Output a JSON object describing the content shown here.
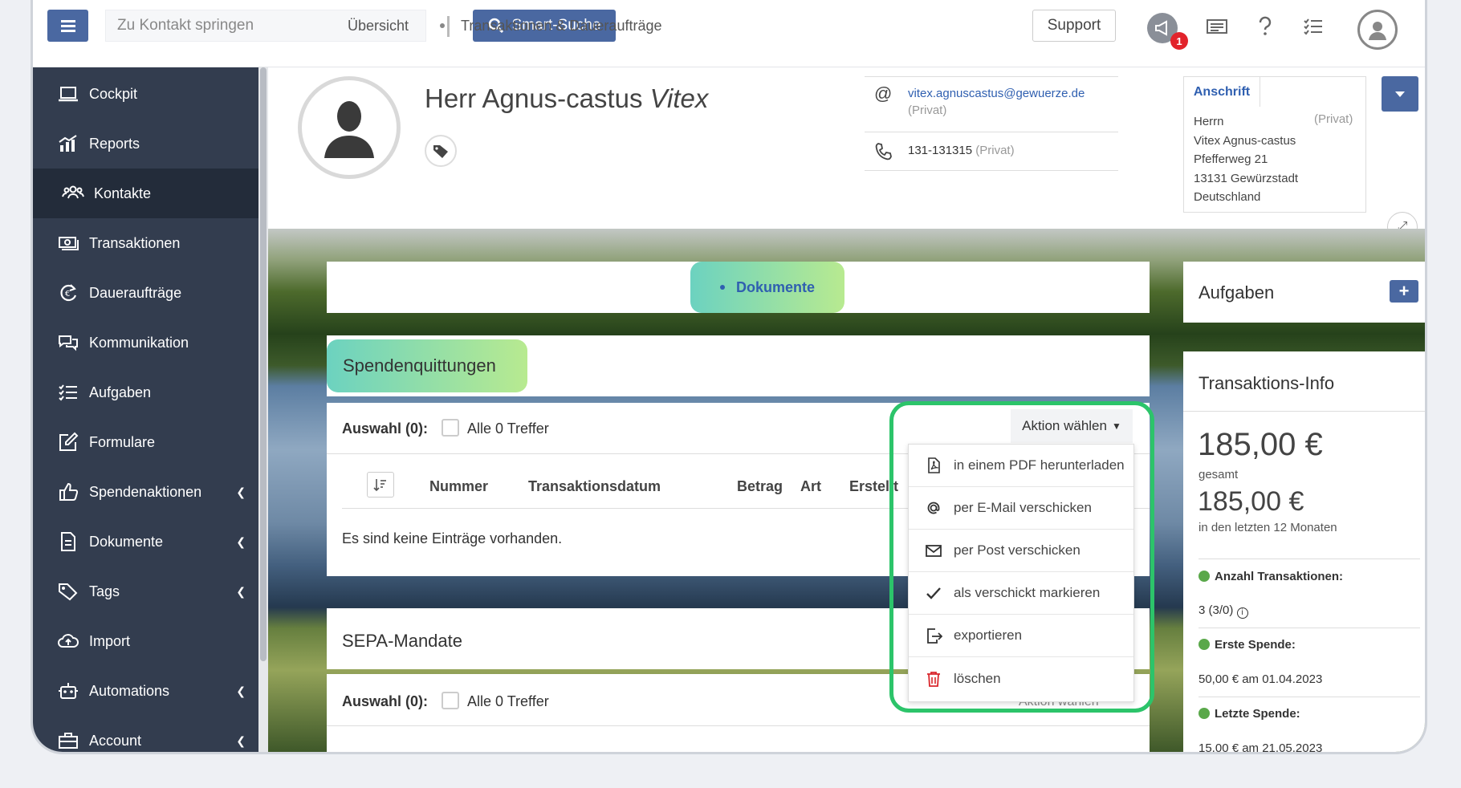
{
  "topbar": {
    "jump_placeholder": "Zu Kontakt springen",
    "smart_search": "Smart-Suche",
    "support": "Support",
    "notification_count": "1"
  },
  "sidebar": {
    "items": [
      {
        "label": "Cockpit",
        "icon": "laptop-icon"
      },
      {
        "label": "Reports",
        "icon": "chart-icon"
      },
      {
        "label": "Kontakte",
        "icon": "users-icon"
      },
      {
        "label": "Transaktionen",
        "icon": "money-icon"
      },
      {
        "label": "Daueraufträge",
        "icon": "recurring-icon"
      },
      {
        "label": "Kommunikation",
        "icon": "chat-icon"
      },
      {
        "label": "Aufgaben",
        "icon": "tasks-icon"
      },
      {
        "label": "Formulare",
        "icon": "edit-icon"
      },
      {
        "label": "Spendenaktionen",
        "icon": "thumbs-up-icon"
      },
      {
        "label": "Dokumente",
        "icon": "document-icon"
      },
      {
        "label": "Tags",
        "icon": "tags-icon"
      },
      {
        "label": "Import",
        "icon": "cloud-upload-icon"
      },
      {
        "label": "Automations",
        "icon": "robot-icon"
      },
      {
        "label": "Account",
        "icon": "briefcase-icon"
      }
    ]
  },
  "profile": {
    "salutation": "Herr Agnus-castus",
    "surname": "Vitex",
    "email": "vitex.agnuscastus@gewuerze.de",
    "email_type": "(Privat)",
    "phone": "131-131315",
    "phone_type": "(Privat)",
    "address_tab": "Anschrift",
    "address_type": "(Privat)",
    "address_lines": [
      "Herrn",
      "Vitex Agnus-castus",
      "Pfefferweg 21",
      "13131 Gewürzstadt",
      "Deutschland"
    ]
  },
  "tabs": {
    "overview": "Übersicht",
    "transactions": "Transaktionen & Daueraufträge",
    "documents": "Dokumente"
  },
  "spendenquittungen": {
    "title": "Spendenquittungen",
    "selection": "Auswahl (0):",
    "all_hits": "Alle 0 Treffer",
    "action": "Aktion wählen",
    "columns": [
      "Nummer",
      "Transaktionsdatum",
      "Betrag",
      "Art",
      "Erstellt"
    ],
    "empty": "Es sind keine Einträge vorhanden."
  },
  "action_menu": [
    {
      "label": "in einem PDF herunterladen",
      "icon": "pdf-icon"
    },
    {
      "label": "per E-Mail verschicken",
      "icon": "at-icon"
    },
    {
      "label": "per Post verschicken",
      "icon": "envelope-icon"
    },
    {
      "label": "als verschickt markieren",
      "icon": "check-icon"
    },
    {
      "label": "exportieren",
      "icon": "export-icon"
    },
    {
      "label": "löschen",
      "icon": "trash-icon"
    }
  ],
  "sepa": {
    "title": "SEPA-Mandate",
    "selection": "Auswahl (0):",
    "all_hits": "Alle 0 Treffer",
    "action": "Aktion wählen"
  },
  "aufgaben": {
    "title": "Aufgaben",
    "add": "+"
  },
  "transaktions_info": {
    "title": "Transaktions-Info",
    "total": "185,00 €",
    "total_label": "gesamt",
    "last12": "185,00 €",
    "last12_label": "in den letzten 12 Monaten",
    "count_label": "Anzahl Transaktionen:",
    "count_value": "3 (3/0)",
    "first_label": "Erste Spende:",
    "first_value": "50,00 € am 01.04.2023",
    "last_label": "Letzte Spende:",
    "last_value": "15,00 € am 21.05.2023"
  },
  "colors": {
    "primary": "#4a68a1",
    "sidebar": "#333d4f",
    "highlight": "#2cc46a",
    "link": "#2f5fb0"
  }
}
